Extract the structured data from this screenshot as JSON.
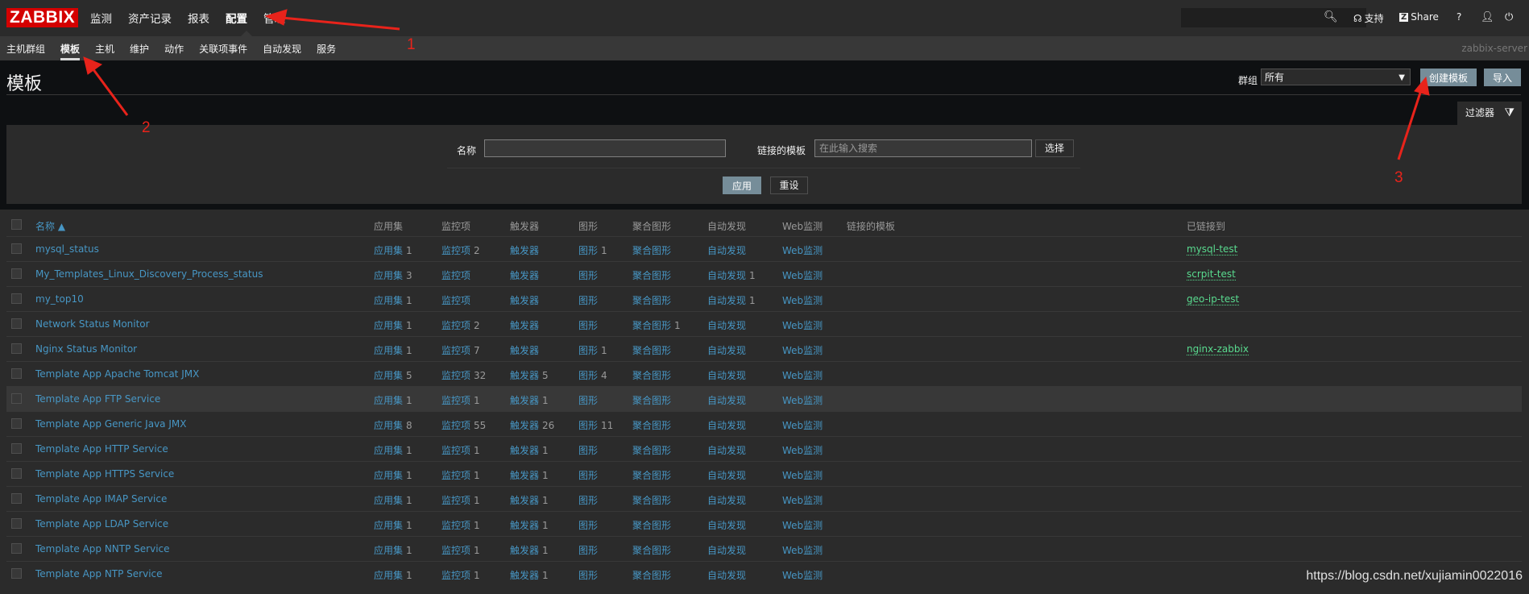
{
  "header": {
    "logo": "ZABBIX",
    "nav": [
      "监测",
      "资产记录",
      "报表",
      "配置",
      "管理"
    ],
    "active_nav": "配置",
    "support": "支持",
    "share": "Share",
    "help": "?"
  },
  "subnav": {
    "items": [
      "主机群组",
      "模板",
      "主机",
      "维护",
      "动作",
      "关联项事件",
      "自动发现",
      "服务"
    ],
    "active": "模板",
    "server": "zabbix-server"
  },
  "page": {
    "title": "模板",
    "group_label": "群组",
    "group_value": "所有",
    "create_button": "创建模板",
    "import_button": "导入"
  },
  "filter": {
    "tab_label": "过滤器",
    "name_label": "名称",
    "name_value": "",
    "linked_label": "链接的模板",
    "linked_placeholder": "在此输入搜索",
    "select_button": "选择",
    "apply_button": "应用",
    "reset_button": "重设"
  },
  "table": {
    "headers": [
      "名称 ▲",
      "应用集",
      "监控项",
      "触发器",
      "图形",
      "聚合图形",
      "自动发现",
      "Web监测",
      "链接的模板",
      "已链接到"
    ],
    "rows": [
      {
        "name": "mysql_status",
        "apps": "1",
        "items": "2",
        "triggers": "",
        "graphs": "1",
        "screens": "",
        "discovery": "",
        "linked_to": "mysql-test"
      },
      {
        "name": "My_Templates_Linux_Discovery_Process_status",
        "apps": "3",
        "items": "",
        "triggers": "",
        "graphs": "",
        "screens": "",
        "discovery": "1",
        "linked_to": "scrpit-test"
      },
      {
        "name": "my_top10",
        "apps": "1",
        "items": "",
        "triggers": "",
        "graphs": "",
        "screens": "",
        "discovery": "1",
        "linked_to": "geo-ip-test"
      },
      {
        "name": "Network Status Monitor",
        "apps": "1",
        "items": "2",
        "triggers": "",
        "graphs": "",
        "screens": "1",
        "discovery": "",
        "linked_to": ""
      },
      {
        "name": "Nginx Status Monitor",
        "apps": "1",
        "items": "7",
        "triggers": "",
        "graphs": "1",
        "screens": "",
        "discovery": "",
        "linked_to": "nginx-zabbix"
      },
      {
        "name": "Template App Apache Tomcat JMX",
        "apps": "5",
        "items": "32",
        "triggers": "5",
        "graphs": "4",
        "screens": "",
        "discovery": "",
        "linked_to": ""
      },
      {
        "name": "Template App FTP Service",
        "apps": "1",
        "items": "1",
        "triggers": "1",
        "graphs": "",
        "screens": "",
        "discovery": "",
        "linked_to": ""
      },
      {
        "name": "Template App Generic Java JMX",
        "apps": "8",
        "items": "55",
        "triggers": "26",
        "graphs": "11",
        "screens": "",
        "discovery": "",
        "linked_to": ""
      },
      {
        "name": "Template App HTTP Service",
        "apps": "1",
        "items": "1",
        "triggers": "1",
        "graphs": "",
        "screens": "",
        "discovery": "",
        "linked_to": ""
      },
      {
        "name": "Template App HTTPS Service",
        "apps": "1",
        "items": "1",
        "triggers": "1",
        "graphs": "",
        "screens": "",
        "discovery": "",
        "linked_to": ""
      },
      {
        "name": "Template App IMAP Service",
        "apps": "1",
        "items": "1",
        "triggers": "1",
        "graphs": "",
        "screens": "",
        "discovery": "",
        "linked_to": ""
      },
      {
        "name": "Template App LDAP Service",
        "apps": "1",
        "items": "1",
        "triggers": "1",
        "graphs": "",
        "screens": "",
        "discovery": "",
        "linked_to": ""
      },
      {
        "name": "Template App NNTP Service",
        "apps": "1",
        "items": "1",
        "triggers": "1",
        "graphs": "",
        "screens": "",
        "discovery": "",
        "linked_to": ""
      },
      {
        "name": "Template App NTP Service",
        "apps": "1",
        "items": "1",
        "triggers": "1",
        "graphs": "",
        "screens": "",
        "discovery": "",
        "linked_to": ""
      }
    ],
    "link_labels": {
      "apps": "应用集",
      "items": "监控项",
      "triggers": "触发器",
      "graphs": "图形",
      "screens": "聚合图形",
      "discovery": "自动发现",
      "web": "Web监测"
    }
  },
  "annotations": [
    "1",
    "2",
    "3"
  ],
  "watermark": "https://blog.csdn.net/xujiamin0022016",
  "colors": {
    "logo": "#d40000",
    "link": "#4796c4",
    "linked_host": "#59db8f",
    "button": "#768d99",
    "annotation": "#e8231b"
  }
}
